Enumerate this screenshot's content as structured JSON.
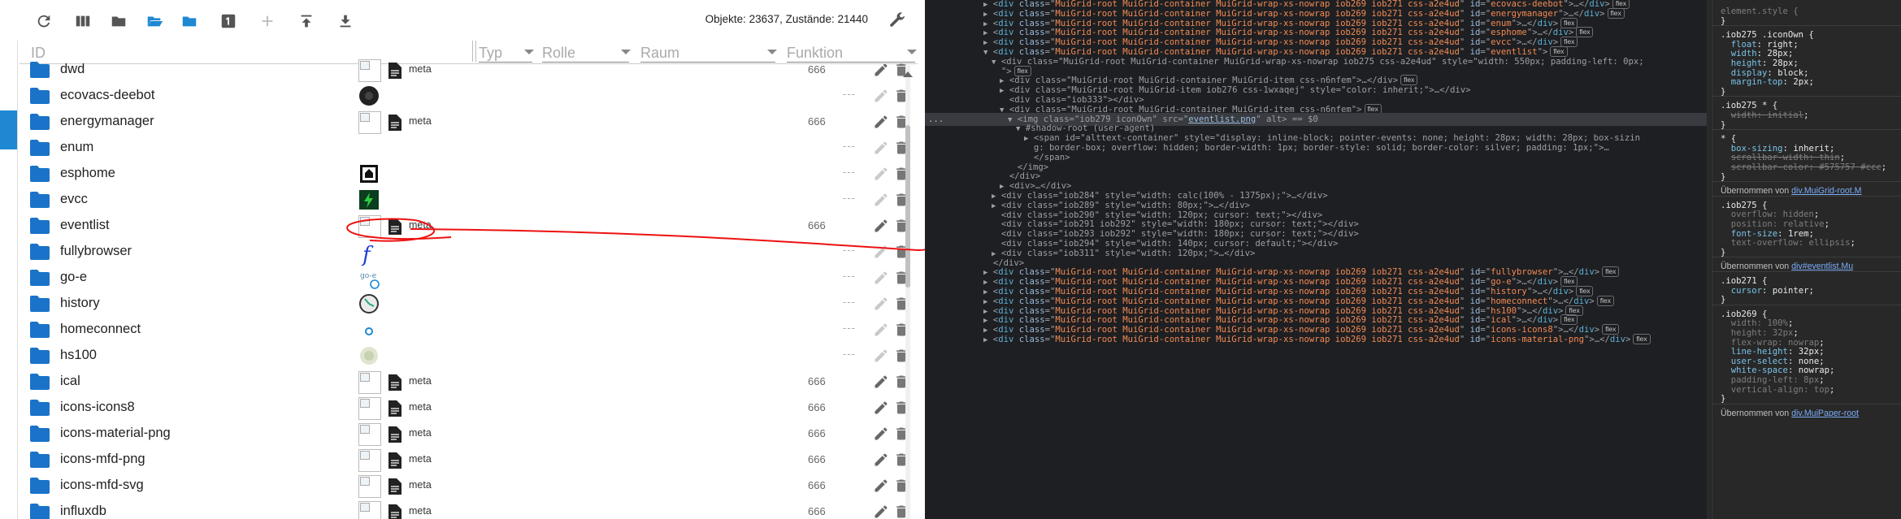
{
  "toolbar": {
    "stats": "Objekte: 23637, Zustände: 21440",
    "icons": [
      "refresh-icon",
      "columns-icon",
      "folder-icon",
      "folder-open-icon",
      "folder-blue-icon",
      "number-one-icon",
      "add-icon",
      "upload-icon",
      "download-icon",
      "wrench-icon"
    ]
  },
  "table": {
    "headers": {
      "id": "ID",
      "type": "Typ",
      "role": "Rolle",
      "room": "Raum",
      "function": "Funktion"
    },
    "rows": [
      {
        "name": "dwd",
        "meta": "meta",
        "num": "666",
        "icon": "broken",
        "editable": true
      },
      {
        "name": "ecovacs-deebot",
        "meta": "",
        "num": "",
        "icon": "ecovacs",
        "editable": false
      },
      {
        "name": "energymanager",
        "meta": "meta",
        "num": "666",
        "icon": "broken",
        "editable": true
      },
      {
        "name": "enum",
        "meta": "",
        "num": "",
        "icon": "none",
        "editable": false
      },
      {
        "name": "esphome",
        "meta": "",
        "num": "",
        "icon": "esphome",
        "editable": false
      },
      {
        "name": "evcc",
        "meta": "",
        "num": "",
        "icon": "evcc",
        "editable": false
      },
      {
        "name": "eventlist",
        "meta": "meta",
        "num": "666",
        "icon": "broken",
        "editable": true
      },
      {
        "name": "fullybrowser",
        "meta": "",
        "num": "",
        "icon": "fully",
        "editable": false
      },
      {
        "name": "go-e",
        "meta": "",
        "num": "",
        "icon": "goe",
        "editable": false
      },
      {
        "name": "history",
        "meta": "",
        "num": "",
        "icon": "history",
        "editable": false
      },
      {
        "name": "homeconnect",
        "meta": "",
        "num": "",
        "icon": "homeconnect",
        "editable": false
      },
      {
        "name": "hs100",
        "meta": "",
        "num": "",
        "icon": "hs100",
        "editable": false
      },
      {
        "name": "ical",
        "meta": "meta",
        "num": "666",
        "icon": "broken",
        "editable": true
      },
      {
        "name": "icons-icons8",
        "meta": "meta",
        "num": "666",
        "icon": "broken",
        "editable": true
      },
      {
        "name": "icons-material-png",
        "meta": "meta",
        "num": "666",
        "icon": "broken",
        "editable": true
      },
      {
        "name": "icons-mfd-png",
        "meta": "meta",
        "num": "666",
        "icon": "broken",
        "editable": true
      },
      {
        "name": "icons-mfd-svg",
        "meta": "meta",
        "num": "666",
        "icon": "broken",
        "editable": true
      },
      {
        "name": "influxdb",
        "meta": "meta",
        "num": "666",
        "icon": "broken",
        "editable": true
      }
    ]
  },
  "devtools": {
    "lines": [
      {
        "indent": 0,
        "tri": "▶",
        "cls": "MuiGrid-root MuiGrid-container MuiGrid-wrap-xs-nowrap iob269 iob271 css-a2e4ud",
        "id": "ecovacs-deebot",
        "flex": "flex",
        "kind": "row"
      },
      {
        "indent": 0,
        "tri": "▶",
        "cls": "MuiGrid-root MuiGrid-container MuiGrid-wrap-xs-nowrap iob269 iob271 css-a2e4ud",
        "id": "energymanager",
        "flex": "flex",
        "kind": "row"
      },
      {
        "indent": 0,
        "tri": "▶",
        "cls": "MuiGrid-root MuiGrid-container MuiGrid-wrap-xs-nowrap iob269 iob271 css-a2e4ud",
        "id": "enum",
        "flex": "flex",
        "kind": "row"
      },
      {
        "indent": 0,
        "tri": "▶",
        "cls": "MuiGrid-root MuiGrid-container MuiGrid-wrap-xs-nowrap iob269 iob271 css-a2e4ud",
        "id": "esphome",
        "flex": "flex",
        "kind": "row"
      },
      {
        "indent": 0,
        "tri": "▶",
        "cls": "MuiGrid-root MuiGrid-container MuiGrid-wrap-xs-nowrap iob269 iob271 css-a2e4ud",
        "id": "evcc",
        "flex": "flex",
        "kind": "row"
      },
      {
        "indent": 0,
        "tri": "▼",
        "cls": "MuiGrid-root MuiGrid-container MuiGrid-wrap-xs-nowrap iob269 iob271 css-a2e4ud",
        "id": "eventlist",
        "flex": "flex",
        "kind": "rowopen"
      },
      {
        "indent": 1,
        "tri": "▼",
        "raw": "<div class=\"MuiGrid-root MuiGrid-container MuiGrid-wrap-xs-nowrap iob275 css-a2e4ud\" style=\"width: 550px; padding-left: 0px;"
      },
      {
        "indent": 1,
        "tri": "",
        "raw": "\">",
        "flex": "flex"
      },
      {
        "indent": 2,
        "tri": "▶",
        "raw": "<div class=\"MuiGrid-root MuiGrid-container MuiGrid-item css-n6nfem\">…</div>",
        "flex": "flex"
      },
      {
        "indent": 2,
        "tri": "▶",
        "raw": "<div class=\"MuiGrid-root MuiGrid-item iob276 css-1wxaqej\" style=\"color: inherit;\">…</div>"
      },
      {
        "indent": 2,
        "tri": "",
        "raw": "<div class=\"iob333\"></div>"
      },
      {
        "indent": 2,
        "tri": "▼",
        "raw": "<div class=\"MuiGrid-root MuiGrid-container MuiGrid-item css-n6nfem\">",
        "flex": "flex"
      },
      {
        "indent": 3,
        "tri": "▼",
        "raw": "<img class=\"iob279 iconOwn\" src=\"",
        "link": "eventlist.png",
        "raw2": "\" alt> == $0",
        "hl": true
      },
      {
        "indent": 4,
        "tri": "▼",
        "raw": "#shadow-root (user-agent)"
      },
      {
        "indent": 5,
        "tri": "▶",
        "raw": "<span id=\"alttext-container\" style=\"display: inline-block; pointer-events: none; height: 28px; width: 28px; box-sizin"
      },
      {
        "indent": 5,
        "tri": "",
        "raw": "g: border-box; overflow: hidden; border-width: 1px; border-style: solid; border-color: silver; padding: 1px;\">…"
      },
      {
        "indent": 5,
        "tri": "",
        "raw": "</span>"
      },
      {
        "indent": 3,
        "tri": "",
        "raw": "</img>"
      },
      {
        "indent": 2,
        "tri": "",
        "raw": "</div>"
      },
      {
        "indent": 2,
        "tri": "▶",
        "raw": "<div>…</div>"
      },
      {
        "indent": 1,
        "tri": "▶",
        "raw": "<div class=\"iob284\" style=\"width: calc(100% - 1375px);\">…</div>"
      },
      {
        "indent": 1,
        "tri": "▶",
        "raw": "<div class=\"iob289\" style=\"width: 80px;\">…</div>"
      },
      {
        "indent": 1,
        "tri": "",
        "raw": "<div class=\"iob290\" style=\"width: 120px; cursor: text;\"></div>"
      },
      {
        "indent": 1,
        "tri": "",
        "raw": "<div class=\"iob291 iob292\" style=\"width: 180px; cursor: text;\"></div>"
      },
      {
        "indent": 1,
        "tri": "",
        "raw": "<div class=\"iob293 iob292\" style=\"width: 180px; cursor: text;\"></div>"
      },
      {
        "indent": 1,
        "tri": "",
        "raw": "<div class=\"iob294\" style=\"width: 140px; cursor: default;\"></div>"
      },
      {
        "indent": 1,
        "tri": "▶",
        "raw": "<div class=\"iob311\" style=\"width: 120px;\">…</div>"
      },
      {
        "indent": 0,
        "tri": "",
        "raw": "</div>"
      },
      {
        "indent": 0,
        "tri": "▶",
        "cls": "MuiGrid-root MuiGrid-container MuiGrid-wrap-xs-nowrap iob269 iob271 css-a2e4ud",
        "id": "fullybrowser",
        "flex": "flex",
        "kind": "row"
      },
      {
        "indent": 0,
        "tri": "▶",
        "cls": "MuiGrid-root MuiGrid-container MuiGrid-wrap-xs-nowrap iob269 iob271 css-a2e4ud",
        "id": "go-e",
        "flex": "flex",
        "kind": "row"
      },
      {
        "indent": 0,
        "tri": "▶",
        "cls": "MuiGrid-root MuiGrid-container MuiGrid-wrap-xs-nowrap iob269 iob271 css-a2e4ud",
        "id": "history",
        "flex": "flex",
        "kind": "row"
      },
      {
        "indent": 0,
        "tri": "▶",
        "cls": "MuiGrid-root MuiGrid-container MuiGrid-wrap-xs-nowrap iob269 iob271 css-a2e4ud",
        "id": "homeconnect",
        "flex": "flex",
        "kind": "row"
      },
      {
        "indent": 0,
        "tri": "▶",
        "cls": "MuiGrid-root MuiGrid-container MuiGrid-wrap-xs-nowrap iob269 iob271 css-a2e4ud",
        "id": "hs100",
        "flex": "flex",
        "kind": "row"
      },
      {
        "indent": 0,
        "tri": "▶",
        "cls": "MuiGrid-root MuiGrid-container MuiGrid-wrap-xs-nowrap iob269 iob271 css-a2e4ud",
        "id": "ical",
        "flex": "flex",
        "kind": "row"
      },
      {
        "indent": 0,
        "tri": "▶",
        "cls": "MuiGrid-root MuiGrid-container MuiGrid-wrap-xs-nowrap iob269 iob271 css-a2e4ud",
        "id": "icons-icons8",
        "flex": "flex",
        "kind": "row"
      },
      {
        "indent": 0,
        "tri": "▶",
        "cls": "MuiGrid-root MuiGrid-container MuiGrid-wrap-xs-nowrap iob269 iob271 css-a2e4ud",
        "id": "icons-material-png",
        "flex": "flex",
        "kind": "row"
      }
    ],
    "gutter_dots": "...",
    "styles": {
      "element_style": "element.style {",
      "close": "}",
      "r1_sel": ".iob275 .iconOwn {",
      "r1": [
        [
          "float",
          "right"
        ],
        [
          "width",
          "28px"
        ],
        [
          "height",
          "28px"
        ],
        [
          "display",
          "block"
        ],
        [
          "margin-top",
          "2px"
        ]
      ],
      "r2_sel": ".iob275 * {",
      "r2": [
        [
          "width",
          "initial"
        ]
      ],
      "r3_sel": "* {",
      "r3": [
        [
          "box-sizing",
          "inherit"
        ],
        [
          "scrollbar-width",
          "thin"
        ],
        [
          "scrollbar-color",
          "#575757 #ccc"
        ]
      ],
      "inh1_label": "Übernommen von",
      "inh1_link": "div.MuiGrid-root.M",
      "r4_sel": ".iob275 {",
      "r4": [
        [
          "overflow",
          "hidden"
        ],
        [
          "position",
          "relative"
        ],
        [
          "font-size",
          "1rem"
        ],
        [
          "text-overflow",
          "ellipsis"
        ]
      ],
      "inh2_label": "Übernommen von",
      "inh2_link": "div#eventlist.Mu",
      "r5_sel": ".iob271 {",
      "r5": [
        [
          "cursor",
          "pointer"
        ]
      ],
      "r6_sel": ".iob269 {",
      "r6": [
        [
          "width",
          "100%"
        ],
        [
          "height",
          "32px"
        ],
        [
          "flex-wrap",
          "nowrap"
        ],
        [
          "line-height",
          "32px"
        ],
        [
          "user-select",
          "none"
        ],
        [
          "white-space",
          "nowrap"
        ],
        [
          "padding-left",
          "8px"
        ],
        [
          "vertical-align",
          "top"
        ]
      ],
      "inh3_label": "Übernommen von",
      "inh3_link": "div.MuiPaper-root"
    }
  }
}
